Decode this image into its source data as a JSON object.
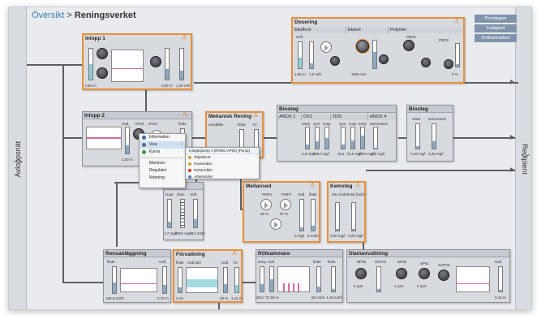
{
  "breadcrumb": {
    "root": "Översikt",
    "separator": ">",
    "current": "Reningsverket"
  },
  "side": {
    "left": "Avloppsnät",
    "right": "Recipient"
  },
  "buttons": [
    "Provtagare",
    "Fastighet",
    "Driftinstruktion"
  ],
  "modules": {
    "inlopp1": {
      "title": "Inlopp 1",
      "labels": [
        "nivå",
        "APO1",
        "APO6",
        "APO7",
        "nivå",
        "flöde"
      ],
      "values": [
        "0,84 m",
        "0,82 m",
        "1,20 m/h"
      ]
    },
    "inlopp2": {
      "title": "Inlopp 2",
      "labels": [
        "nivå",
        "APO1",
        "APO2",
        "flöde"
      ],
      "values": [
        "1,00 m",
        "1,20 m/h"
      ]
    },
    "mekanisk": {
      "title": "Mekanisk Rening",
      "labels": [
        "sandfälla",
        "flöde",
        "TS"
      ]
    },
    "dosering": {
      "title": "Dosering",
      "subs": [
        "Ekoflock",
        "Etanol",
        "Polymer"
      ],
      "labels": [
        "nivå",
        "flöde",
        "nivå",
        "flöde",
        "PBO1",
        "PBO2"
      ],
      "values": [
        "1,85 m",
        "1,9 m/h",
        "1590 mm",
        "0 %"
      ]
    },
    "biosteg1": {
      "title": "Biosteg",
      "subs": [
        "ANOX 1",
        "OX1",
        "OX5",
        "ANOX 4"
      ],
      "labels": [
        "nitrat",
        "syre",
        "susp",
        "syre",
        "susp",
        "temp",
        "ammonium"
      ],
      "values": [
        "2,8 mg/l",
        "3864 mg/l",
        "18,1 °C",
        "2,9 mg/l",
        "4184 mg/l",
        "0,0 mg/l"
      ]
    },
    "biosteg2": {
      "title": "Biosteg",
      "labels": [
        "nitrat",
        "ammonium"
      ],
      "values": [
        "0,29 mg/l",
        "2,00 mg/l"
      ]
    },
    "rsl": {
      "title": "RSL",
      "labels": [
        "susp",
        "slam",
        "nivå"
      ],
      "values": [
        "1,7 mg/l",
        "5902 mg/l",
        "412 m3/h"
      ]
    },
    "mellansed": {
      "title": "Mellansed",
      "labels": [
        "PMP1",
        "PMP2",
        "nivå",
        "flöde"
      ],
      "values": [
        "96 %",
        "97 %",
        "0 mg/l",
        "8 m3/h"
      ]
    },
    "kemsteg": {
      "title": "Kemsteg",
      "labels": [
        "orto fosfor",
        "total fosfor"
      ],
      "values": [
        "0,00 mg/l",
        "0,00 mg/l"
      ]
    },
    "rensan": {
      "title": "Rensanläggning",
      "labels": [
        "flöde",
        "nivå"
      ],
      "values": [
        "158,5 m3/h",
        "0,79 m"
      ]
    },
    "forav": {
      "title": "Förvattning",
      "labels": [
        "flöde",
        "nivå kärl",
        "nivå",
        "TS"
      ],
      "values": [
        "3,44",
        "29 %",
        "1,31 m"
      ]
    },
    "rotkammare": {
      "title": "Rötkammare",
      "labels": [
        "temp",
        "nivå",
        "flöde",
        "flöde"
      ],
      "values": [
        "38,5 °C",
        "7,59 m",
        "65 m3/h",
        "4,49 m3/h"
      ]
    },
    "slam": {
      "title": "Slamavvattning",
      "labels": [
        "BP06",
        "SCP01",
        "BP08",
        "SP01",
        "SCP03",
        "nivå"
      ],
      "values": [
        "0 rpm",
        "0 rpm",
        "0 rpm",
        "0,16 m"
      ]
    }
  },
  "context_menu": {
    "items": [
      "Information",
      "Visa",
      "Kurva",
      "Manöver",
      "Regulator",
      "Notering"
    ],
    "submenu_header": "Inloppspump 1 (RNNG.AP01) [Pump]",
    "submenu": [
      "Objektkort",
      "Kvarvisalar",
      "Pekarmålet",
      "Arbetsorder"
    ]
  },
  "colors": {
    "accent": "#e98f3a",
    "link": "#3a7ec0",
    "panel": "#d7dade"
  }
}
